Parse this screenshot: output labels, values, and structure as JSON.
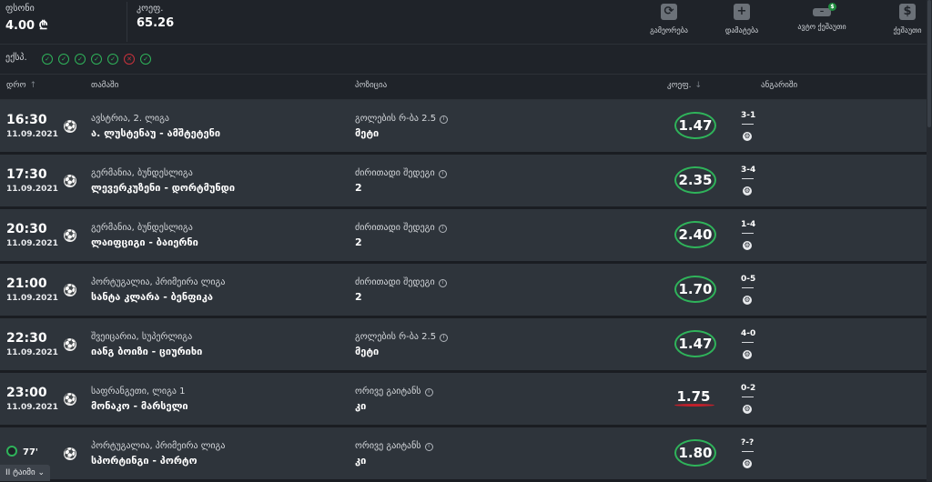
{
  "summary": {
    "amount_label": "ფსონი",
    "amount_value": "4.00 ₾",
    "odds_label": "კოეფ.",
    "odds_value": "65.26"
  },
  "actions": [
    {
      "label": "გამეორება",
      "icon": "repeat-icon",
      "glyph": "⟳"
    },
    {
      "label": "დამატება",
      "icon": "plus-icon",
      "glyph": "+"
    },
    {
      "label": "ავტო ქეშაუთი",
      "icon": "auto-cashout-icon",
      "glyph": "–",
      "badge": "$"
    },
    {
      "label": "ქეშაუთი",
      "icon": "cashout-dollar-icon",
      "glyph": "$"
    }
  ],
  "express": {
    "label": "ექსპ.",
    "checks": [
      "won",
      "won",
      "won",
      "won",
      "won",
      "lost",
      "won"
    ]
  },
  "headers": {
    "date": "დრო",
    "event": "თამაში",
    "market": "პოზიცია",
    "odds": "კოეფ.",
    "result": "ანგარიში",
    "sort_asc": "↑",
    "sort_desc": "↓"
  },
  "rows": [
    {
      "time": "16:30",
      "date": "11.09.2021",
      "league": "ავსტრია, 2. ლიგა",
      "event": "ა. ლუსტენაუ - ამშტეტენი",
      "market": "გოლების რ-ბა 2.5",
      "pick": "მეტი",
      "odds": "1.47",
      "score": "3-1",
      "status": "won"
    },
    {
      "time": "17:30",
      "date": "11.09.2021",
      "league": "გერმანია, ბუნდესლიგა",
      "event": "ლევერკუზენი - დორტმუნდი",
      "market": "ძირითადი შედეგი",
      "pick": "2",
      "odds": "2.35",
      "score": "3-4",
      "status": "won"
    },
    {
      "time": "20:30",
      "date": "11.09.2021",
      "league": "გერმანია, ბუნდესლიგა",
      "event": "ლაიფციგი - ბაიერნი",
      "market": "ძირითადი შედეგი",
      "pick": "2",
      "odds": "2.40",
      "score": "1-4",
      "status": "won"
    },
    {
      "time": "21:00",
      "date": "11.09.2021",
      "league": "პორტუგალია, პრიმეირა ლიგა",
      "event": "სანტა კლარა - ბენფიკა",
      "market": "ძირითადი შედეგი",
      "pick": "2",
      "odds": "1.70",
      "score": "0-5",
      "status": "won"
    },
    {
      "time": "22:30",
      "date": "11.09.2021",
      "league": "შვეიცარია, სუპერლიგა",
      "event": "იანგ ბოიზი - ციურიხი",
      "market": "გოლების რ-ბა 2.5",
      "pick": "მეტი",
      "odds": "1.47",
      "score": "4-0",
      "status": "won"
    },
    {
      "time": "23:00",
      "date": "11.09.2021",
      "league": "საფრანგეთი, ლიგა 1",
      "event": "მონაკო - მარსელი",
      "market": "ორივე გაიტანს",
      "pick": "კი",
      "odds": "1.75",
      "score": "0-2",
      "status": "lost"
    },
    {
      "live_minute": "77'",
      "league": "პორტუგალია, პრიმეირა ლიგა",
      "event": "სპორტინგი - პორტო",
      "market": "ორივე გაიტანს",
      "pick": "კი",
      "odds": "1.80",
      "score": "?-?",
      "status": "won"
    }
  ],
  "bottom_tab": "II ტაიმი"
}
